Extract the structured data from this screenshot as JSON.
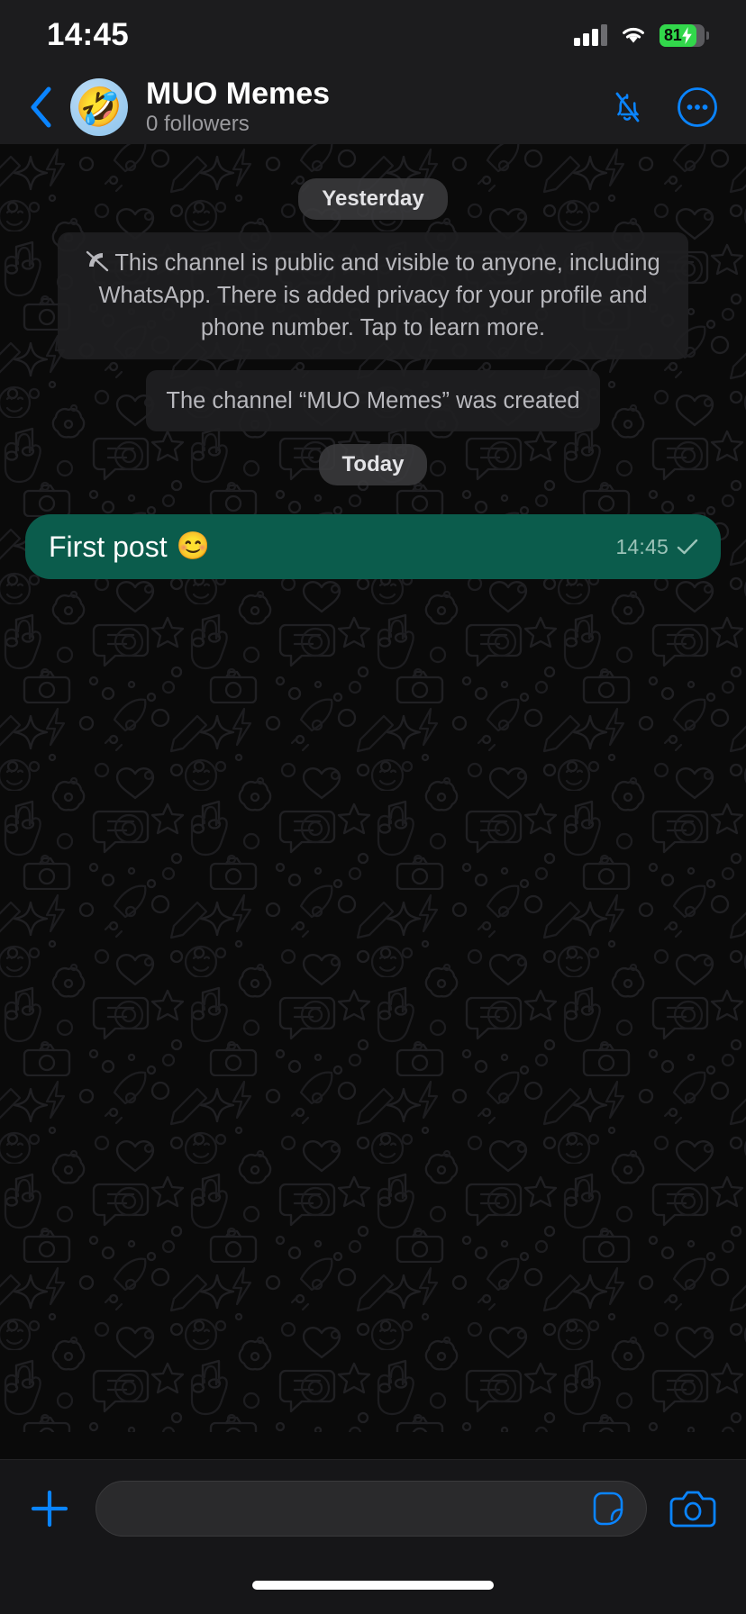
{
  "status_bar": {
    "time": "14:45",
    "battery_percent": "81",
    "battery_level": 81,
    "charging": true,
    "signal_bars": 3,
    "wifi": true,
    "icons": {
      "signal": "cellular-signal-icon",
      "wifi": "wifi-icon",
      "battery": "battery-icon",
      "bolt": "charging-bolt-icon"
    }
  },
  "header": {
    "back_icon": "chevron-left-icon",
    "avatar_emoji": "🤣",
    "title": "MUO Memes",
    "subtitle": "0 followers",
    "mute_icon": "bell-slash-icon",
    "more_icon": "more-circle-icon"
  },
  "chat": {
    "dividers": {
      "yesterday": "Yesterday",
      "today": "Today"
    },
    "system_messages": [
      {
        "icon": "privacy-broadcast-icon",
        "text": "This channel is public and visible to anyone, including WhatsApp. There is added privacy for your profile and phone number. Tap to learn more."
      },
      {
        "icon": "",
        "text": "The channel “MUO Memes” was created"
      }
    ],
    "messages": [
      {
        "text": "First post",
        "emoji": "😊",
        "time": "14:45",
        "status_icon": "single-check-icon",
        "outgoing": true
      }
    ]
  },
  "input_bar": {
    "plus_icon": "plus-icon",
    "input_value": "",
    "input_placeholder": "",
    "sticker_icon": "sticker-icon",
    "camera_icon": "camera-icon"
  },
  "colors": {
    "accent_blue": "#0a84ff",
    "bubble_green": "#0b5c4c",
    "battery_green": "#32d74b",
    "header_bg": "#1c1c1e",
    "chat_bg": "#0a0a0a"
  }
}
